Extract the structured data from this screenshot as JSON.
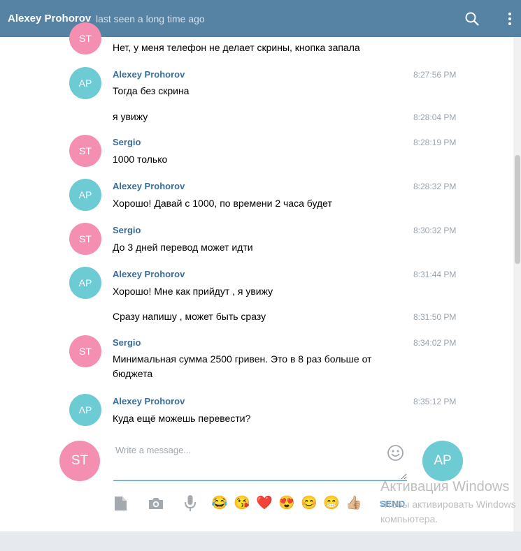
{
  "header": {
    "title": "Alexey Prohorov",
    "status": "last seen a long time ago",
    "search_icon": "search-icon",
    "more_icon": "more-vertical-icon"
  },
  "messages": [
    {
      "initials": "ST",
      "author": "",
      "time": "",
      "text": "Нет, у меня телефон не делает скрины, кнопка запала"
    },
    {
      "initials": "AP",
      "author": "Alexey Prohorov",
      "time": "8:27:56 PM",
      "text": "Тогда без скрина"
    },
    {
      "initials": "",
      "author": "",
      "time": "8:28:04 PM",
      "text": "я увижу"
    },
    {
      "initials": "ST",
      "author": "Sergio",
      "time": "8:28:19 PM",
      "text": "1000 только"
    },
    {
      "initials": "AP",
      "author": "Alexey Prohorov",
      "time": "8:28:32 PM",
      "text": "Хорошо! Давай с 1000, по времени 2 часа будет"
    },
    {
      "initials": "ST",
      "author": "Sergio",
      "time": "8:30:32 PM",
      "text": "До 3 дней перевод может идти"
    },
    {
      "initials": "AP",
      "author": "Alexey Prohorov",
      "time": "8:31:44 PM",
      "text": "Хорошо! Мне как прийдут , я увижу"
    },
    {
      "initials": "",
      "author": "",
      "time": "8:31:50 PM",
      "text": "Сразу напишу , может быть сразу"
    },
    {
      "initials": "ST",
      "author": "Sergio",
      "time": "8:34:02 PM",
      "text": "Минимальная сумма 2500 гривен. Это в 8 раз больше от бюджета"
    },
    {
      "initials": "AP",
      "author": "Alexey Prohorov",
      "time": "8:35:12 PM",
      "text": "Куда ещё можешь перевести?"
    }
  ],
  "composer": {
    "self_initials": "ST",
    "peer_initials": "AP",
    "placeholder": "Write a message...",
    "send_label": "SEND",
    "emojis": [
      "😂",
      "😘",
      "❤️",
      "😍",
      "😊",
      "😁",
      "👍🏼"
    ]
  },
  "watermark": {
    "title": "Активация Windows",
    "line1": "Чтобы активировать Windows",
    "line2": "компьютера."
  },
  "colors": {
    "header": "#5682a3",
    "author": "#3a6d99",
    "avatar_st": "#f48fb1",
    "avatar_ap": "#6ccbd3",
    "send": "#4d91c6"
  }
}
